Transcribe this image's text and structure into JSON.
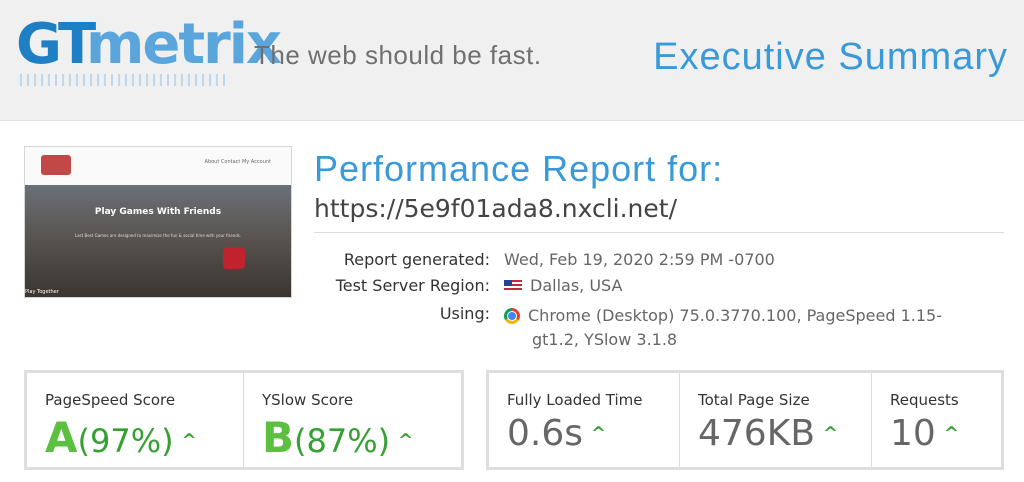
{
  "header": {
    "logo_gt": "GT",
    "logo_metrix": "metrix",
    "tagline": "The web should be fast.",
    "section": "Executive Summary"
  },
  "screenshot": {
    "hero_title": "Play Games With Friends",
    "hero_sub": "Last Best Games are designed to maximize the fun & social time with your friends.",
    "nav": "About   Contact   My Account",
    "bottom": "Play Together"
  },
  "report": {
    "title": "Performance Report for:",
    "url": "https://5e9f01ada8.nxcli.net/",
    "generated_label": "Report generated:",
    "generated_value": "Wed, Feb 19, 2020 2:59 PM -0700",
    "region_label": "Test Server Region:",
    "region_value": "Dallas, USA",
    "using_label": "Using:",
    "using_line1": "Chrome (Desktop) 75.0.3770.100, PageSpeed 1.15-",
    "using_line2": "gt1.2, YSlow 3.1.8",
    "flag_icon": "us-flag-icon",
    "browser_icon": "chrome-icon"
  },
  "scores": {
    "pagespeed_label": "PageSpeed Score",
    "pagespeed_grade": "A",
    "pagespeed_pct": "(97%)",
    "yslow_label": "YSlow Score",
    "yslow_grade": "B",
    "yslow_pct": "(87%)"
  },
  "metrics": {
    "load_label": "Fully Loaded Time",
    "load_value": "0.6s",
    "size_label": "Total Page Size",
    "size_value": "476KB",
    "requests_label": "Requests",
    "requests_value": "10"
  },
  "arrow_glyph": "^",
  "colors": {
    "brand_blue": "#3a99d8",
    "grade_green": "#5bbf3f"
  }
}
